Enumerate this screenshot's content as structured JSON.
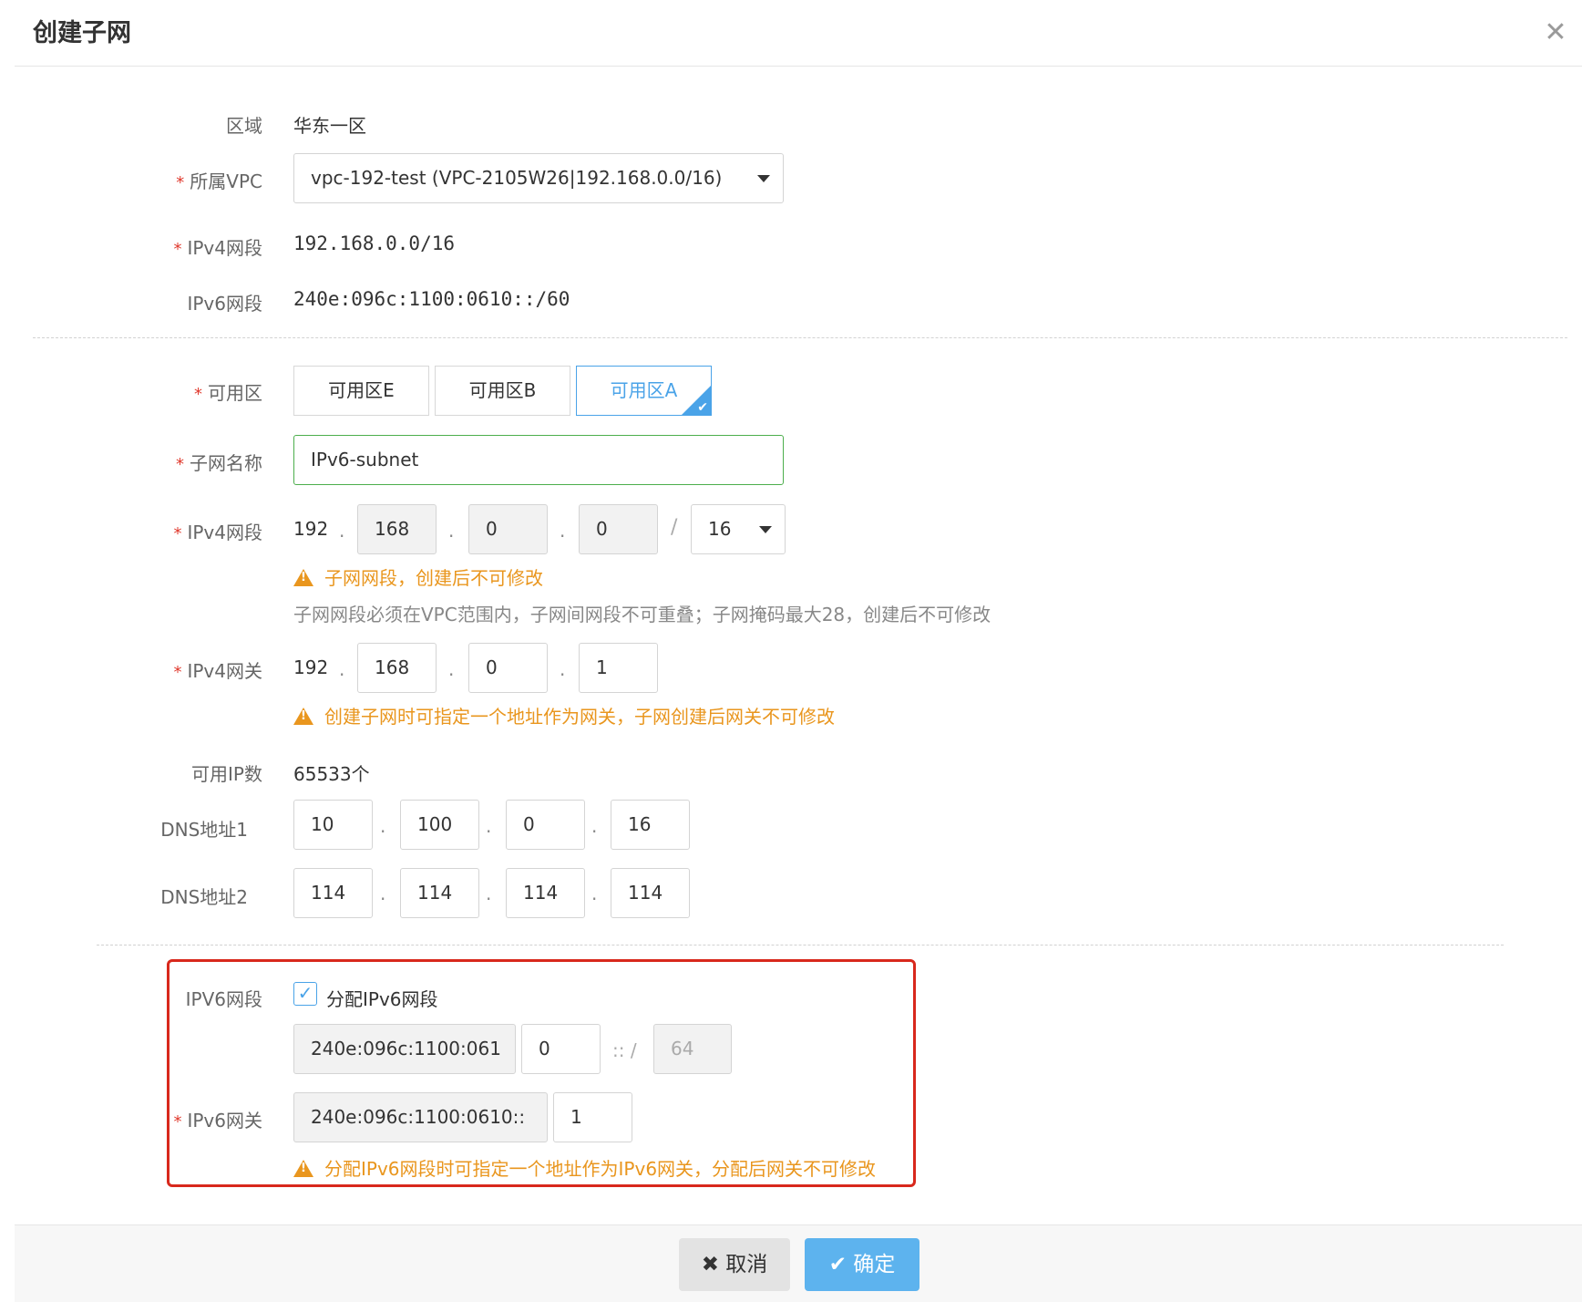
{
  "dialog": {
    "title": "创建子网",
    "close_glyph": "✕"
  },
  "region": {
    "label": "区域",
    "value": "华东一区"
  },
  "vpc": {
    "label": "所属VPC",
    "required": "*",
    "value": "vpc-192-test (VPC-2105W26|192.168.0.0/16)"
  },
  "ipv4_range_vpc": {
    "label": "IPv4网段",
    "required": "*",
    "value": "192.168.0.0/16"
  },
  "ipv6_range_vpc": {
    "label": "IPv6网段",
    "value": "240e:096c:1100:0610::/60"
  },
  "zone": {
    "label": "可用区",
    "required": "*",
    "options": [
      "可用区E",
      "可用区B",
      "可用区A"
    ],
    "selected": "可用区A"
  },
  "subnet_name": {
    "label": "子网名称",
    "required": "*",
    "value": "IPv6-subnet"
  },
  "subnet_ipv4": {
    "label": "IPv4网段",
    "required": "*",
    "octet1": "192",
    "octet2": "168",
    "octet3": "0",
    "octet4": "0",
    "separator": ".",
    "slash": "/",
    "mask": "16",
    "warning": "子网网段，创建后不可修改",
    "hint": "子网网段必须在VPC范围内，子网间网段不可重叠；子网掩码最大28，创建后不可修改"
  },
  "gateway_ipv4": {
    "label": "IPv4网关",
    "required": "*",
    "octet1": "192",
    "octet2": "168",
    "octet3": "0",
    "octet4": "1",
    "warning": "创建子网时可指定一个地址作为网关，子网创建后网关不可修改"
  },
  "available_ips": {
    "label": "可用IP数",
    "value": "65533个"
  },
  "dns1": {
    "label": "DNS地址1",
    "octets": [
      "10",
      "100",
      "0",
      "16"
    ]
  },
  "dns2": {
    "label": "DNS地址2",
    "octets": [
      "114",
      "114",
      "114",
      "114"
    ]
  },
  "ipv6_section": {
    "label": "IPV6网段",
    "checkbox_label": "分配IPv6网段",
    "checked": true,
    "prefix": "240e:096c:1100:061",
    "suffix": "0",
    "sep": ":: /",
    "prefix_len": "64",
    "gateway_label": "IPv6网关",
    "gateway_required": "*",
    "gateway_prefix": "240e:096c:1100:0610::",
    "gateway_suffix": "1",
    "warning": "分配IPv6网段时可指定一个地址作为IPv6网关，分配后网关不可修改"
  },
  "footer": {
    "cancel": "取消",
    "confirm": "确定"
  },
  "colors": {
    "accent": "#4aa3e8",
    "warning": "#e9961e",
    "required": "#e03a2e",
    "highlight_border": "#d8281c",
    "success_border": "#4cae4c"
  }
}
